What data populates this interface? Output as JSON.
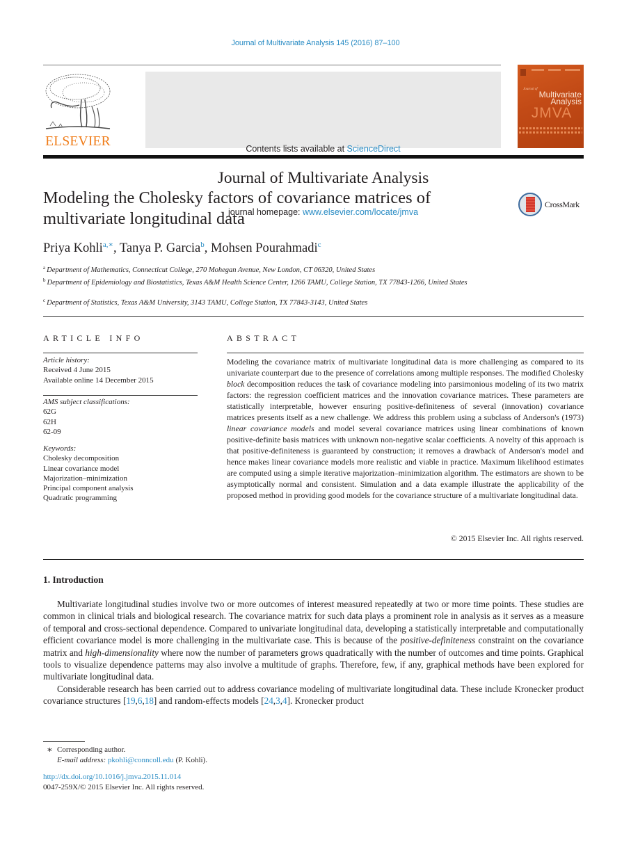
{
  "header": {
    "journal_ref": "Journal of Multivariate Analysis 145 (2016) 87–100",
    "contents_prefix": "Contents lists available at ",
    "contents_link": "ScienceDirect",
    "journal_name": "Journal of Multivariate Analysis",
    "homepage_prefix": "journal homepage: ",
    "homepage_link": "www.elsevier.com/locate/jmva",
    "publisher_logo_text": "ELSEVIER",
    "cover": {
      "journal_of": "Journal of",
      "title_line1": "Multivariate",
      "title_line2": "Analysis",
      "abbr": "JMVA"
    },
    "colors": {
      "link": "#2a8cc4",
      "elsevier_orange": "#f07d1a",
      "cover_orange": "#c24a16"
    }
  },
  "article": {
    "title_line1": "Modeling the Cholesky factors of covariance matrices of",
    "title_line2": "multivariate longitudinal data",
    "crossmark_label": "CrossMark",
    "authors": [
      {
        "name": "Priya Kohli",
        "sup": "a,∗"
      },
      {
        "name": "Tanya P. Garcia",
        "sup": "b"
      },
      {
        "name": "Mohsen Pourahmadi",
        "sup": "c"
      }
    ],
    "affiliations": [
      {
        "sup": "a",
        "text": "Department of Mathematics, Connecticut College, 270 Mohegan Avenue, New London, CT 06320, United States"
      },
      {
        "sup": "b",
        "text": "Department of Epidemiology and Biostatistics, Texas A&M Health Science Center, 1266 TAMU, College Station, TX 77843-1266, United States"
      },
      {
        "sup": "c",
        "text": "Department of Statistics, Texas A&M University, 3143 TAMU, College Station, TX 77843-3143, United States"
      }
    ]
  },
  "article_info": {
    "heading": "ARTICLE INFO",
    "history_label": "Article history:",
    "received": "Received 4 June 2015",
    "available": "Available online 14 December 2015",
    "ams_label": "AMS subject classifications:",
    "ams_codes": [
      "62G",
      "62H",
      "62-09"
    ],
    "keywords_label": "Keywords:",
    "keywords": [
      "Cholesky decomposition",
      "Linear covariance model",
      "Majorization–minimization",
      "Principal component analysis",
      "Quadratic programming"
    ]
  },
  "abstract": {
    "heading": "ABSTRACT",
    "parts": [
      "Modeling the covariance matrix of multivariate longitudinal data is more challenging as compared to its univariate counterpart due to the presence of correlations among multiple responses. The modified Cholesky ",
      "block",
      " decomposition reduces the task of covariance modeling into parsimonious modeling of its two matrix factors: the regression coefficient matrices and the innovation covariance matrices. These parameters are statistically interpretable, however ensuring positive-definiteness of several (innovation) covariance matrices presents itself as a new challenge. We address this problem using a subclass of Anderson's (1973) ",
      "linear covariance models",
      " and model several covariance matrices using linear combinations of known positive-definite basis matrices with unknown non-negative scalar coefficients. A novelty of this approach is that positive-definiteness is guaranteed by construction; it removes a drawback of Anderson's model and hence makes linear covariance models more realistic and viable in practice. Maximum likelihood estimates are computed using a simple iterative majorization–minimization algorithm. The estimators are shown to be asymptotically normal and consistent. Simulation and a data example illustrate the applicability of the proposed method in providing good models for the covariance structure of a multivariate longitudinal data."
    ],
    "copyright": "© 2015 Elsevier Inc. All rights reserved."
  },
  "introduction": {
    "heading": "1. Introduction",
    "p1_parts": [
      "Multivariate longitudinal studies involve two or more outcomes of interest measured repeatedly at two or more time points. These studies are common in clinical trials and biological research. The covariance matrix for such data plays a prominent role in analysis as it serves as a measure of temporal and cross-sectional dependence. Compared to univariate longitudinal data, developing a statistically interpretable and computationally efficient covariance model is more challenging in the multivariate case. This is because of the ",
      "positive-definiteness",
      " constraint on the covariance matrix and ",
      "high-dimensionality",
      " where now the number of parameters grows quadratically with the number of outcomes and time points. Graphical tools to visualize dependence patterns may also involve a multitude of graphs. Therefore, few, if any, graphical methods have been explored for multivariate longitudinal data."
    ],
    "p2_text1": "Considerable research has been carried out to address covariance modeling of multivariate longitudinal data. These include Kronecker product covariance structures [",
    "p2_refs1": [
      "19",
      "6",
      "18"
    ],
    "p2_text2": "] and random-effects models [",
    "p2_refs2": [
      "24",
      "3",
      "4"
    ],
    "p2_text3": "]. Kronecker product"
  },
  "footnotes": {
    "star": "∗",
    "corresponding": "Corresponding author.",
    "email_label": "E-mail address:",
    "email": "pkohli@conncoll.edu",
    "email_suffix": " (P. Kohli).",
    "doi": "http://dx.doi.org/10.1016/j.jmva.2015.11.014",
    "issn_copyright": "0047-259X/© 2015 Elsevier Inc. All rights reserved."
  }
}
